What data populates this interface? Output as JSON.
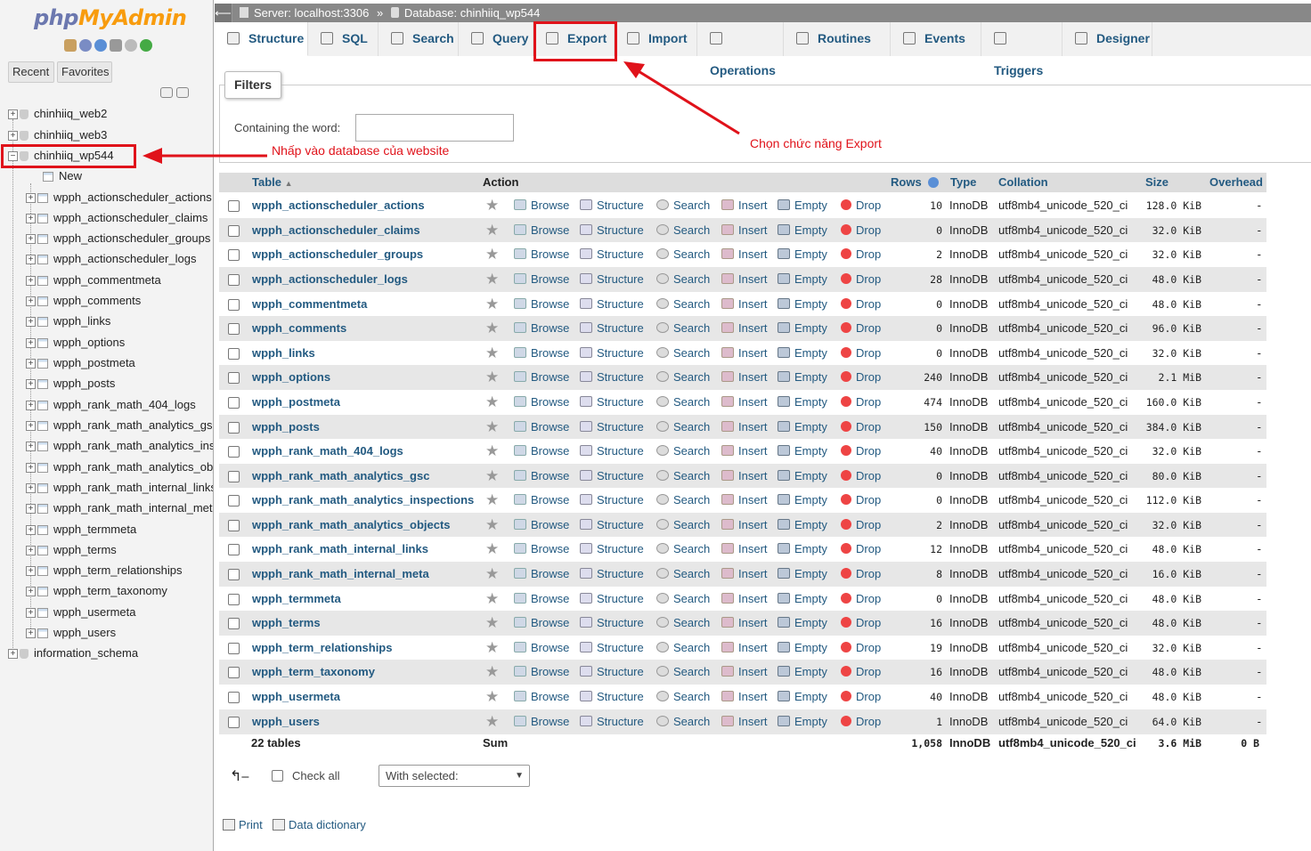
{
  "sidebar": {
    "logo_php": "php",
    "logo_myadmin": "MyAdmin",
    "recent_label": "Recent",
    "favorites_label": "Favorites",
    "databases": [
      "chinhiiq_web2",
      "chinhiiq_web3",
      "chinhiiq_wp544"
    ],
    "new_label": "New",
    "tables": [
      "wpph_actionscheduler_actions",
      "wpph_actionscheduler_claims",
      "wpph_actionscheduler_groups",
      "wpph_actionscheduler_logs",
      "wpph_commentmeta",
      "wpph_comments",
      "wpph_links",
      "wpph_options",
      "wpph_postmeta",
      "wpph_posts",
      "wpph_rank_math_404_logs",
      "wpph_rank_math_analytics_gsc",
      "wpph_rank_math_analytics_inspections",
      "wpph_rank_math_analytics_objects",
      "wpph_rank_math_internal_links",
      "wpph_rank_math_internal_meta",
      "wpph_termmeta",
      "wpph_terms",
      "wpph_term_relationships",
      "wpph_term_taxonomy",
      "wpph_usermeta",
      "wpph_users"
    ],
    "info_schema": "information_schema"
  },
  "breadcrumb": {
    "server": "Server: localhost:3306",
    "separator": "»",
    "database": "Database: chinhiiq_wp544"
  },
  "tabs": [
    "Structure",
    "SQL",
    "Search",
    "Query",
    "Export",
    "Import",
    "Operations",
    "Routines",
    "Events",
    "Triggers",
    "Designer"
  ],
  "filters": {
    "legend": "Filters",
    "label": "Containing the word:",
    "value": ""
  },
  "annotations": {
    "db_note": "Nhấp vào database của website",
    "export_note": "Chọn chức năng Export",
    "accent": "#e0121a"
  },
  "table_headers": {
    "table": "Table",
    "action": "Action",
    "rows": "Rows",
    "type": "Type",
    "collation": "Collation",
    "size": "Size",
    "overhead": "Overhead"
  },
  "actions": [
    "Browse",
    "Structure",
    "Search",
    "Insert",
    "Empty",
    "Drop"
  ],
  "rows": [
    {
      "name": "wpph_actionscheduler_actions",
      "rows": "10",
      "type": "InnoDB",
      "collation": "utf8mb4_unicode_520_ci",
      "size": "128.0 KiB",
      "overhead": "-"
    },
    {
      "name": "wpph_actionscheduler_claims",
      "rows": "0",
      "type": "InnoDB",
      "collation": "utf8mb4_unicode_520_ci",
      "size": "32.0 KiB",
      "overhead": "-"
    },
    {
      "name": "wpph_actionscheduler_groups",
      "rows": "2",
      "type": "InnoDB",
      "collation": "utf8mb4_unicode_520_ci",
      "size": "32.0 KiB",
      "overhead": "-"
    },
    {
      "name": "wpph_actionscheduler_logs",
      "rows": "28",
      "type": "InnoDB",
      "collation": "utf8mb4_unicode_520_ci",
      "size": "48.0 KiB",
      "overhead": "-"
    },
    {
      "name": "wpph_commentmeta",
      "rows": "0",
      "type": "InnoDB",
      "collation": "utf8mb4_unicode_520_ci",
      "size": "48.0 KiB",
      "overhead": "-"
    },
    {
      "name": "wpph_comments",
      "rows": "0",
      "type": "InnoDB",
      "collation": "utf8mb4_unicode_520_ci",
      "size": "96.0 KiB",
      "overhead": "-"
    },
    {
      "name": "wpph_links",
      "rows": "0",
      "type": "InnoDB",
      "collation": "utf8mb4_unicode_520_ci",
      "size": "32.0 KiB",
      "overhead": "-"
    },
    {
      "name": "wpph_options",
      "rows": "240",
      "type": "InnoDB",
      "collation": "utf8mb4_unicode_520_ci",
      "size": "2.1 MiB",
      "overhead": "-"
    },
    {
      "name": "wpph_postmeta",
      "rows": "474",
      "type": "InnoDB",
      "collation": "utf8mb4_unicode_520_ci",
      "size": "160.0 KiB",
      "overhead": "-"
    },
    {
      "name": "wpph_posts",
      "rows": "150",
      "type": "InnoDB",
      "collation": "utf8mb4_unicode_520_ci",
      "size": "384.0 KiB",
      "overhead": "-"
    },
    {
      "name": "wpph_rank_math_404_logs",
      "rows": "40",
      "type": "InnoDB",
      "collation": "utf8mb4_unicode_520_ci",
      "size": "32.0 KiB",
      "overhead": "-"
    },
    {
      "name": "wpph_rank_math_analytics_gsc",
      "rows": "0",
      "type": "InnoDB",
      "collation": "utf8mb4_unicode_520_ci",
      "size": "80.0 KiB",
      "overhead": "-"
    },
    {
      "name": "wpph_rank_math_analytics_inspections",
      "rows": "0",
      "type": "InnoDB",
      "collation": "utf8mb4_unicode_520_ci",
      "size": "112.0 KiB",
      "overhead": "-"
    },
    {
      "name": "wpph_rank_math_analytics_objects",
      "rows": "2",
      "type": "InnoDB",
      "collation": "utf8mb4_unicode_520_ci",
      "size": "32.0 KiB",
      "overhead": "-"
    },
    {
      "name": "wpph_rank_math_internal_links",
      "rows": "12",
      "type": "InnoDB",
      "collation": "utf8mb4_unicode_520_ci",
      "size": "48.0 KiB",
      "overhead": "-"
    },
    {
      "name": "wpph_rank_math_internal_meta",
      "rows": "8",
      "type": "InnoDB",
      "collation": "utf8mb4_unicode_520_ci",
      "size": "16.0 KiB",
      "overhead": "-"
    },
    {
      "name": "wpph_termmeta",
      "rows": "0",
      "type": "InnoDB",
      "collation": "utf8mb4_unicode_520_ci",
      "size": "48.0 KiB",
      "overhead": "-"
    },
    {
      "name": "wpph_terms",
      "rows": "16",
      "type": "InnoDB",
      "collation": "utf8mb4_unicode_520_ci",
      "size": "48.0 KiB",
      "overhead": "-"
    },
    {
      "name": "wpph_term_relationships",
      "rows": "19",
      "type": "InnoDB",
      "collation": "utf8mb4_unicode_520_ci",
      "size": "32.0 KiB",
      "overhead": "-"
    },
    {
      "name": "wpph_term_taxonomy",
      "rows": "16",
      "type": "InnoDB",
      "collation": "utf8mb4_unicode_520_ci",
      "size": "48.0 KiB",
      "overhead": "-"
    },
    {
      "name": "wpph_usermeta",
      "rows": "40",
      "type": "InnoDB",
      "collation": "utf8mb4_unicode_520_ci",
      "size": "48.0 KiB",
      "overhead": "-"
    },
    {
      "name": "wpph_users",
      "rows": "1",
      "type": "InnoDB",
      "collation": "utf8mb4_unicode_520_ci",
      "size": "64.0 KiB",
      "overhead": "-"
    }
  ],
  "summary": {
    "tables": "22 tables",
    "sum": "Sum",
    "rows": "1,058",
    "type": "InnoDB",
    "collation": "utf8mb4_unicode_520_ci",
    "size": "3.6 MiB",
    "overhead": "0 B"
  },
  "bulk": {
    "check_all": "Check all",
    "with_selected": "With selected:"
  },
  "footer": {
    "print": "Print",
    "data_dictionary": "Data dictionary"
  }
}
